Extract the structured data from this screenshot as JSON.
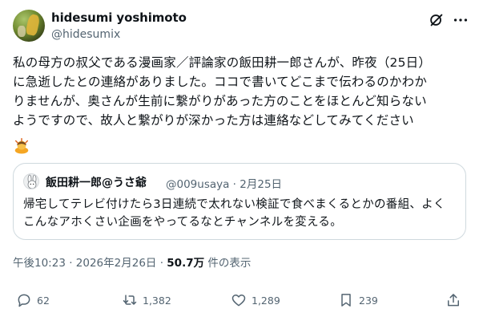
{
  "author": {
    "name": "hidesumi yoshimoto",
    "handle": "@hidesumix"
  },
  "tweet": {
    "text": "私の母方の叔父である漫画家／評論家の飯田耕一郎さんが、昨夜（25日）\nに急逝したとの連絡がありました。ココで書いてどこまで伝わるのかわか\nりませんが、奥さんが生前に繋がりがあった方のことをほとんど知らない\nようですので、故人と繋がりが深かった方は連絡などしてみてください",
    "emoji_icon": "bowing-person-icon"
  },
  "quote": {
    "name": "飯田耕一郎@うさ爺",
    "handle_date": "@009usaya · 2月25日",
    "text": "帰宅してテレビ付けたら3日連続で太れない検証で食べまくるとかの番組、よく\nこんなアホくさい企画をやってるなとチャンネルを変える。"
  },
  "meta": {
    "time_date": "午後10:23 · 2026年2月26日 · ",
    "views_count": "50.7万",
    "views_label": " 件の表示"
  },
  "actions": {
    "replies": "62",
    "reposts": "1,382",
    "likes": "1,289",
    "bookmarks": "239"
  },
  "colors": {
    "text": "#0f1419",
    "secondary": "#536471",
    "border": "#cfd9de"
  }
}
